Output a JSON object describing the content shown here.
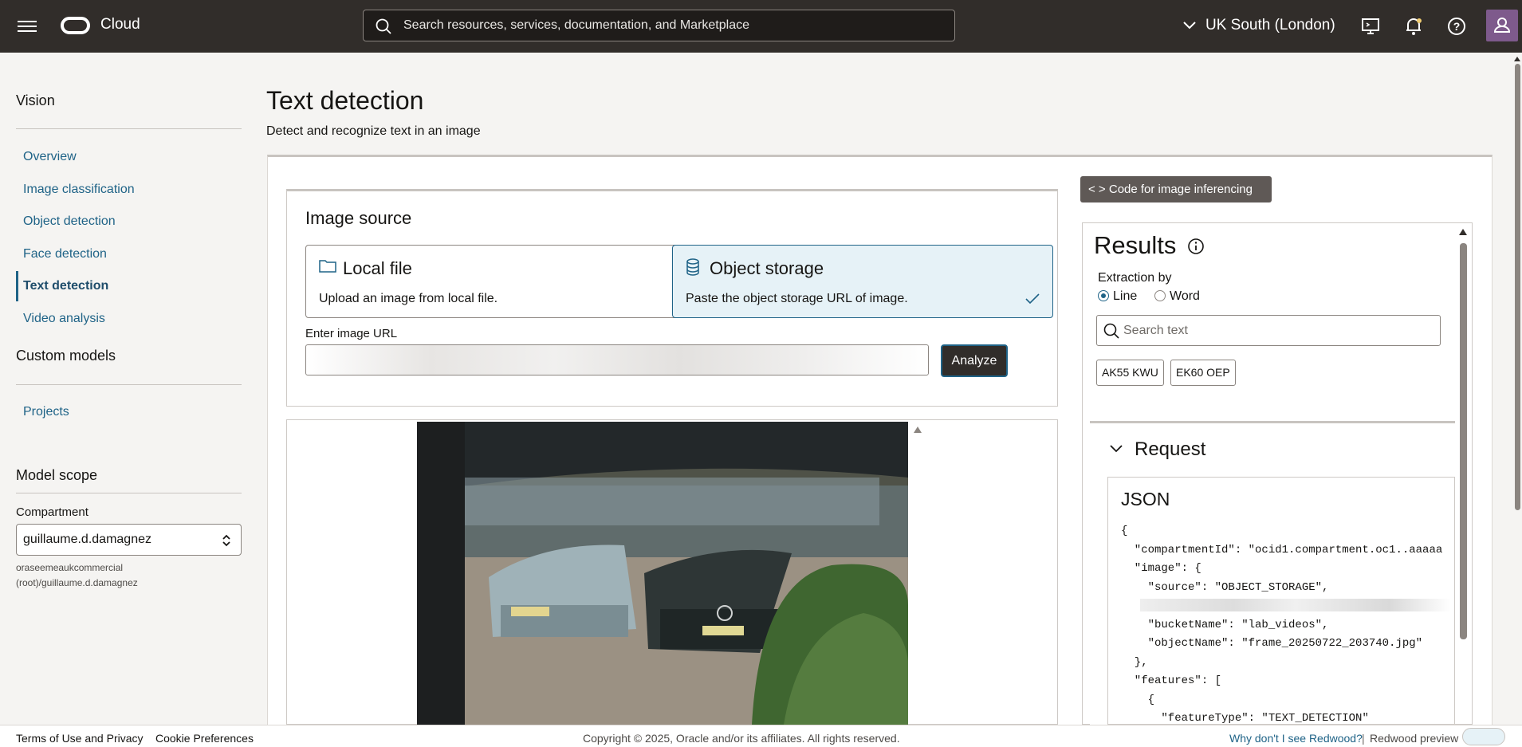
{
  "header": {
    "app_name": "Cloud",
    "search_placeholder": "Search resources, services, documentation, and Marketplace",
    "region": "UK South (London)"
  },
  "sidebar": {
    "section_title": "Vision",
    "items": [
      {
        "label": "Overview"
      },
      {
        "label": "Image classification"
      },
      {
        "label": "Object detection"
      },
      {
        "label": "Face detection"
      },
      {
        "label": "Text detection"
      },
      {
        "label": "Video analysis"
      }
    ],
    "custom_models_title": "Custom models",
    "custom_items": [
      {
        "label": "Projects"
      }
    ],
    "model_scope_title": "Model scope",
    "compartment_label": "Compartment",
    "compartment_value": "guillaume.d.damagnez",
    "compartment_path": "oraseemeaukcommercial (root)/guillaume.d.damagnez"
  },
  "main": {
    "title": "Text detection",
    "subtitle": "Detect and recognize text in an image",
    "image_source": {
      "title": "Image source",
      "options": [
        {
          "title": "Local file",
          "desc": "Upload an image from local file."
        },
        {
          "title": "Object storage",
          "desc": "Paste the object storage URL of image."
        }
      ],
      "url_label": "Enter image URL",
      "analyze_label": "Analyze"
    }
  },
  "results": {
    "code_button": "Code for image inferencing",
    "title": "Results",
    "extraction_label": "Extraction by",
    "options": [
      "Line",
      "Word"
    ],
    "search_placeholder": "Search text",
    "chips": [
      "AK55 KWU",
      "EK60 OEP"
    ],
    "request_title": "Request",
    "json_title": "JSON",
    "json_text": "{\n  \"compartmentId\": \"ocid1.compartment.oc1..aaaaa\n  \"image\": {\n    \"source\": \"OBJECT_STORAGE\",\n    \n    \"bucketName\": \"lab_videos\",\n    \"objectName\": \"frame_20250722_203740.jpg\"\n  },\n  \"features\": [\n    {\n      \"featureType\": \"TEXT_DETECTION\""
  },
  "footer": {
    "terms": "Terms of Use and Privacy",
    "cookies": "Cookie Preferences",
    "copyright": "Copyright © 2025, Oracle and/or its affiliates. All rights reserved.",
    "redwood_link": "Why don't I see Redwood?",
    "separator": "|",
    "redwood_preview": "Redwood preview"
  }
}
